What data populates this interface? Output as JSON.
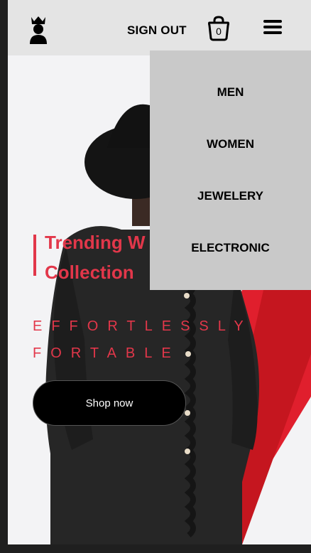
{
  "header": {
    "sign_out_label": "SIGN OUT",
    "cart_count": "0"
  },
  "hero": {
    "headline": "Trending W\nCollection",
    "tagline": "EFFORTLESSLY FORTABLE",
    "shop_button_label": "Shop now"
  },
  "dropdown": {
    "items": [
      {
        "label": "MEN"
      },
      {
        "label": "WOMEN"
      },
      {
        "label": "JEWELERY"
      },
      {
        "label": "ELECTRONIC"
      }
    ]
  },
  "colors": {
    "accent": "#e2374a",
    "dropdown_bg": "#c9c9c9",
    "header_bg": "#e4e4e4"
  },
  "icons": [
    "crowned-user-icon",
    "shopping-bag-icon",
    "hamburger-menu-icon"
  ]
}
